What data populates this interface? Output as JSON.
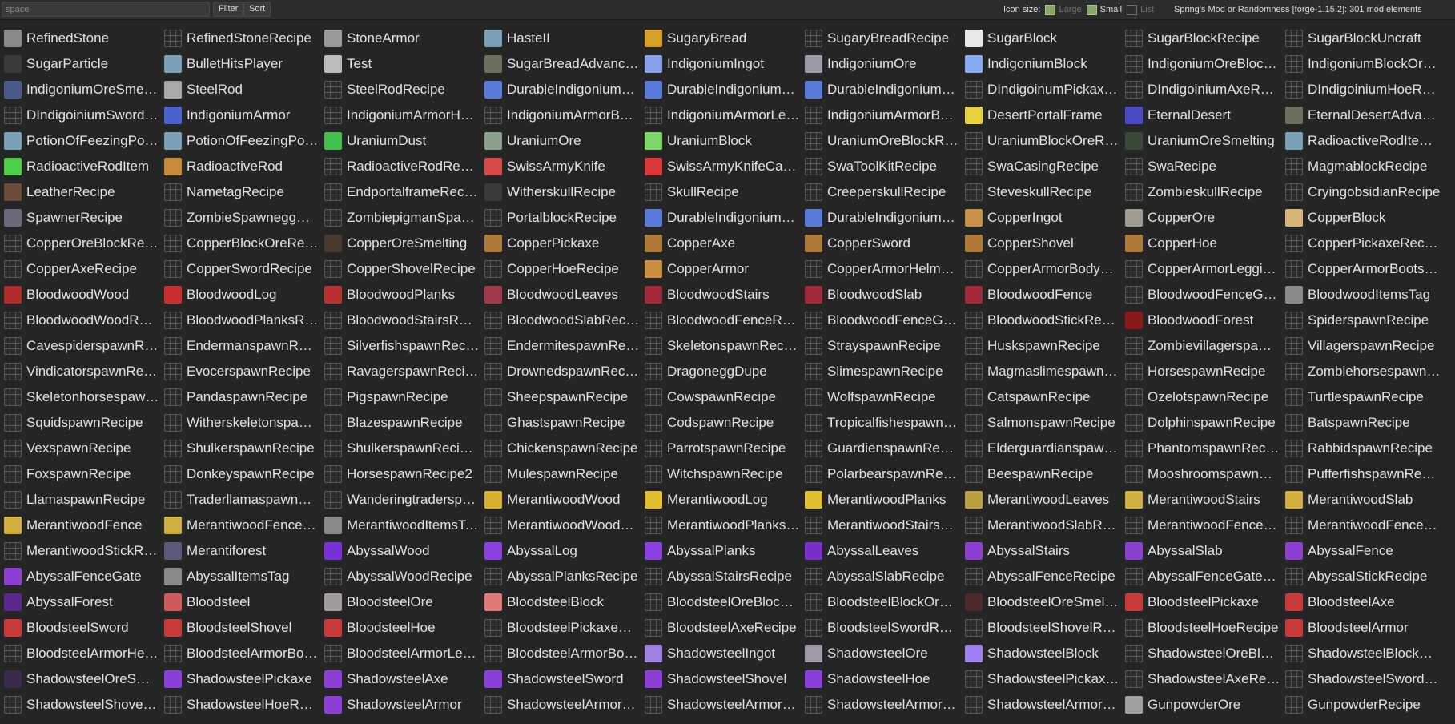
{
  "toolbar": {
    "search_placeholder": "space",
    "filter_label": "Filter",
    "sort_label": "Sort",
    "icon_size_label": "Icon size:",
    "large_label": "Large",
    "small_label": "Small",
    "list_label": "List",
    "workspace_info": "Spring's Mod or Randomness [forge-1.15.2]: 301 mod elements"
  },
  "elements": [
    {
      "name": "RefinedStone",
      "icon": "#8a8a8a"
    },
    {
      "name": "RefinedStoneRecipe",
      "icon": "recipe"
    },
    {
      "name": "StoneArmor",
      "icon": "#9a9a9a"
    },
    {
      "name": "HasteII",
      "icon": "#7aa0b8"
    },
    {
      "name": "SugaryBread",
      "icon": "#d9a12a"
    },
    {
      "name": "SugaryBreadRecipe",
      "icon": "recipe"
    },
    {
      "name": "SugarBlock",
      "icon": "#e8e8e8"
    },
    {
      "name": "SugarBlockRecipe",
      "icon": "recipe"
    },
    {
      "name": "SugarBlockUncraft",
      "icon": "recipe"
    },
    {
      "name": "SugarParticle",
      "icon": "#3a3a3a"
    },
    {
      "name": "BulletHitsPlayer",
      "icon": "#7aa0b8"
    },
    {
      "name": "Test",
      "icon": "#bbbbbb"
    },
    {
      "name": "SugarBreadAdvancement",
      "icon": "#6f6f5f"
    },
    {
      "name": "IndigoniumIngot",
      "icon": "#8aa0e8"
    },
    {
      "name": "IndigoniumOre",
      "icon": "#9a9aa8"
    },
    {
      "name": "IndigoniumBlock",
      "icon": "#8aaaf0"
    },
    {
      "name": "IndigoniumOreBlockRecipe",
      "icon": "recipe"
    },
    {
      "name": "IndigoniumBlockOreRecipe",
      "icon": "recipe"
    },
    {
      "name": "IndigoniumOreSmelting",
      "icon": "#4a5a8a"
    },
    {
      "name": "SteelRod",
      "icon": "#aaaaaa"
    },
    {
      "name": "SteelRodRecipe",
      "icon": "recipe"
    },
    {
      "name": "DurableIndigoniumPickaxe",
      "icon": "#5a7ad8"
    },
    {
      "name": "DurableIndigoniumAxe",
      "icon": "#5a7ad8"
    },
    {
      "name": "DurableIndigoniumSword",
      "icon": "#5a7ad8"
    },
    {
      "name": "DIndigoinumPickaxeRecipe",
      "icon": "recipe"
    },
    {
      "name": "DIndigoiniumAxeRecipe",
      "icon": "recipe"
    },
    {
      "name": "DIndigoiniumHoeRecipe",
      "icon": "recipe"
    },
    {
      "name": "DIndigoiniumSwordRecipe",
      "icon": "recipe"
    },
    {
      "name": "IndigoniumArmor",
      "icon": "#4a62d0"
    },
    {
      "name": "IndigoniumArmorHelmetRecipe",
      "icon": "recipe"
    },
    {
      "name": "IndigoniumArmorBodyRecipe",
      "icon": "recipe"
    },
    {
      "name": "IndigoniumArmorLeggingsRecipe",
      "icon": "recipe"
    },
    {
      "name": "IndigoniumArmorBootsRecipe",
      "icon": "recipe"
    },
    {
      "name": "DesertPortalFrame",
      "icon": "#e6d240"
    },
    {
      "name": "EternalDesert",
      "icon": "#4a4ac8"
    },
    {
      "name": "EternalDesertAdvancement",
      "icon": "#6f6f5f"
    },
    {
      "name": "PotionOfFeezingPotion",
      "icon": "#7aa0b8"
    },
    {
      "name": "PotionOfFeezingPotionEffect",
      "icon": "#7aa0b8"
    },
    {
      "name": "UraniumDust",
      "icon": "#3ec24a"
    },
    {
      "name": "UraniumOre",
      "icon": "#8aa08a"
    },
    {
      "name": "UraniumBlock",
      "icon": "#7ad86a"
    },
    {
      "name": "UraniumOreBlockRecipe",
      "icon": "recipe"
    },
    {
      "name": "UraniumBlockOreRecipe",
      "icon": "recipe"
    },
    {
      "name": "UraniumOreSmelting",
      "icon": "#3a4a3a"
    },
    {
      "name": "RadioactiveRodItemRecipe",
      "icon": "#7aa0b8"
    },
    {
      "name": "RadioactiveRodItem",
      "icon": "#4ad04a"
    },
    {
      "name": "RadioactiveRod",
      "icon": "#c88a3a"
    },
    {
      "name": "RadioactiveRodRecipe",
      "icon": "recipe"
    },
    {
      "name": "SwissArmyKnife",
      "icon": "#d84a4a"
    },
    {
      "name": "SwissArmyKnifeCasing",
      "icon": "#d83a3a"
    },
    {
      "name": "SwaToolKitRecipe",
      "icon": "recipe"
    },
    {
      "name": "SwaCasingRecipe",
      "icon": "recipe"
    },
    {
      "name": "SwaRecipe",
      "icon": "recipe"
    },
    {
      "name": "MagmablockRecipe",
      "icon": "recipe"
    },
    {
      "name": "LeatherRecipe",
      "icon": "#6a4a3a"
    },
    {
      "name": "NametagRecipe",
      "icon": "recipe"
    },
    {
      "name": "EndportalframeRecipe",
      "icon": "recipe"
    },
    {
      "name": "WitherskullRecipe",
      "icon": "#3a3a3a"
    },
    {
      "name": "SkullRecipe",
      "icon": "recipe"
    },
    {
      "name": "CreeperskullRecipe",
      "icon": "recipe"
    },
    {
      "name": "SteveskullRecipe",
      "icon": "recipe"
    },
    {
      "name": "ZombieskullRecipe",
      "icon": "recipe"
    },
    {
      "name": "CryingobsidianRecipe",
      "icon": "recipe"
    },
    {
      "name": "SpawnerRecipe",
      "icon": "#6a6a7a"
    },
    {
      "name": "ZombieSpawneggRecipe",
      "icon": "recipe"
    },
    {
      "name": "ZombiepigmanSpawneggRecipe",
      "icon": "recipe"
    },
    {
      "name": "PortalblockRecipe",
      "icon": "recipe"
    },
    {
      "name": "DurableIndigoniumShovel",
      "icon": "#5a7ad8"
    },
    {
      "name": "DurableIndigoniumHoe",
      "icon": "#5a7ad8"
    },
    {
      "name": "CopperIngot",
      "icon": "#c8904a"
    },
    {
      "name": "CopperOre",
      "icon": "#a09a90"
    },
    {
      "name": "CopperBlock",
      "icon": "#d8b47a"
    },
    {
      "name": "CopperOreBlockRecipe",
      "icon": "recipe"
    },
    {
      "name": "CopperBlockOreRecipe",
      "icon": "recipe"
    },
    {
      "name": "CopperOreSmelting",
      "icon": "#4a3a2a"
    },
    {
      "name": "CopperPickaxe",
      "icon": "#b0783a"
    },
    {
      "name": "CopperAxe",
      "icon": "#b0783a"
    },
    {
      "name": "CopperSword",
      "icon": "#b0783a"
    },
    {
      "name": "CopperShovel",
      "icon": "#b0783a"
    },
    {
      "name": "CopperHoe",
      "icon": "#b0783a"
    },
    {
      "name": "CopperPickaxeRecipe",
      "icon": "recipe"
    },
    {
      "name": "CopperAxeRecipe",
      "icon": "recipe"
    },
    {
      "name": "CopperSwordRecipe",
      "icon": "recipe"
    },
    {
      "name": "CopperShovelRecipe",
      "icon": "recipe"
    },
    {
      "name": "CopperHoeRecipe",
      "icon": "recipe"
    },
    {
      "name": "CopperArmor",
      "icon": "#c89040"
    },
    {
      "name": "CopperArmorHelmetRecipe",
      "icon": "recipe"
    },
    {
      "name": "CopperArmorBodyRecipe",
      "icon": "recipe"
    },
    {
      "name": "CopperArmorLeggingsRecipe",
      "icon": "recipe"
    },
    {
      "name": "CopperArmorBootsRecipe",
      "icon": "recipe"
    },
    {
      "name": "BloodwoodWood",
      "icon": "#b02a2a"
    },
    {
      "name": "BloodwoodLog",
      "icon": "#c83030"
    },
    {
      "name": "BloodwoodPlanks",
      "icon": "#b83030"
    },
    {
      "name": "BloodwoodLeaves",
      "icon": "#a03a4a"
    },
    {
      "name": "BloodwoodStairs",
      "icon": "#a02a3a"
    },
    {
      "name": "BloodwoodSlab",
      "icon": "#a02a3a"
    },
    {
      "name": "BloodwoodFence",
      "icon": "#a02a3a"
    },
    {
      "name": "BloodwoodFenceGateRecipe",
      "icon": "recipe"
    },
    {
      "name": "BloodwoodItemsTag",
      "icon": "#8a8a8a"
    },
    {
      "name": "BloodwoodWoodRecipe",
      "icon": "recipe"
    },
    {
      "name": "BloodwoodPlanksRecipe",
      "icon": "recipe"
    },
    {
      "name": "BloodwoodStairsRecipe",
      "icon": "recipe"
    },
    {
      "name": "BloodwoodSlabRecipe",
      "icon": "recipe"
    },
    {
      "name": "BloodwoodFenceRecipe",
      "icon": "recipe"
    },
    {
      "name": "BloodwoodFenceGateRecipe",
      "icon": "recipe"
    },
    {
      "name": "BloodwoodStickRecipe",
      "icon": "recipe"
    },
    {
      "name": "BloodwoodForest",
      "icon": "#8a1a1a"
    },
    {
      "name": "SpiderspawnRecipe",
      "icon": "recipe"
    },
    {
      "name": "CavespiderspawnRecipe",
      "icon": "recipe"
    },
    {
      "name": "EndermanspawnRecipe",
      "icon": "recipe"
    },
    {
      "name": "SilverfishspawnRecipe",
      "icon": "recipe"
    },
    {
      "name": "EndermitespawnRecipe",
      "icon": "recipe"
    },
    {
      "name": "SkeletonspawnRecipe",
      "icon": "recipe"
    },
    {
      "name": "StrayspawnRecipe",
      "icon": "recipe"
    },
    {
      "name": "HuskspawnRecipe",
      "icon": "recipe"
    },
    {
      "name": "ZombievillagerspawnRecipe",
      "icon": "recipe"
    },
    {
      "name": "VillagerspawnRecipe",
      "icon": "recipe"
    },
    {
      "name": "VindicatorspawnRecipe",
      "icon": "recipe"
    },
    {
      "name": "EvocerspawnRecipe",
      "icon": "recipe"
    },
    {
      "name": "RavagerspawnRecipe",
      "icon": "recipe"
    },
    {
      "name": "DrownedspawnRecipe",
      "icon": "recipe"
    },
    {
      "name": "DragoneggDupe",
      "icon": "recipe"
    },
    {
      "name": "SlimespawnRecipe",
      "icon": "recipe"
    },
    {
      "name": "MagmaslimespawnRecipe",
      "icon": "recipe"
    },
    {
      "name": "HorsespawnRecipe",
      "icon": "recipe"
    },
    {
      "name": "ZombiehorsespawnRecipe",
      "icon": "recipe"
    },
    {
      "name": "SkeletonhorsespawnRecipe",
      "icon": "recipe"
    },
    {
      "name": "PandaspawnRecipe",
      "icon": "recipe"
    },
    {
      "name": "PigspawnRecipe",
      "icon": "recipe"
    },
    {
      "name": "SheepspawnRecipe",
      "icon": "recipe"
    },
    {
      "name": "CowspawnRecipe",
      "icon": "recipe"
    },
    {
      "name": "WolfspawnRecipe",
      "icon": "recipe"
    },
    {
      "name": "CatspawnRecipe",
      "icon": "recipe"
    },
    {
      "name": "OzelotspawnRecipe",
      "icon": "recipe"
    },
    {
      "name": "TurtlespawnRecipe",
      "icon": "recipe"
    },
    {
      "name": "SquidspawnRecipe",
      "icon": "recipe"
    },
    {
      "name": "WitherskeletonspawnRecipe",
      "icon": "recipe"
    },
    {
      "name": "BlazespawnRecipe",
      "icon": "recipe"
    },
    {
      "name": "GhastspawnRecipe",
      "icon": "recipe"
    },
    {
      "name": "CodspawnRecipe",
      "icon": "recipe"
    },
    {
      "name": "TropicalfishespawnRecipe",
      "icon": "recipe"
    },
    {
      "name": "SalmonspawnRecipe",
      "icon": "recipe"
    },
    {
      "name": "DolphinspawnRecipe",
      "icon": "recipe"
    },
    {
      "name": "BatspawnRecipe",
      "icon": "recipe"
    },
    {
      "name": "VexspawnRecipe",
      "icon": "recipe"
    },
    {
      "name": "ShulkerspawnRecipe",
      "icon": "recipe"
    },
    {
      "name": "ShulkerspawnRecipe2",
      "icon": "recipe"
    },
    {
      "name": "ChickenspawnRecipe",
      "icon": "recipe"
    },
    {
      "name": "ParrotspawnRecipe",
      "icon": "recipe"
    },
    {
      "name": "GuardienspawnRecipe",
      "icon": "recipe"
    },
    {
      "name": "ElderguardianspawnRecipe",
      "icon": "recipe"
    },
    {
      "name": "PhantomspawnRecipe",
      "icon": "recipe"
    },
    {
      "name": "RabbidspawnRecipe",
      "icon": "recipe"
    },
    {
      "name": "FoxspawnRecipe",
      "icon": "recipe"
    },
    {
      "name": "DonkeyspawnRecipe",
      "icon": "recipe"
    },
    {
      "name": "HorsespawnRecipe2",
      "icon": "recipe"
    },
    {
      "name": "MulespawnRecipe",
      "icon": "recipe"
    },
    {
      "name": "WitchspawnRecipe",
      "icon": "recipe"
    },
    {
      "name": "PolarbearspawnRecipe",
      "icon": "recipe"
    },
    {
      "name": "BeespawnRecipe",
      "icon": "recipe"
    },
    {
      "name": "MooshroomspawnRecipe",
      "icon": "recipe"
    },
    {
      "name": "PufferfishspawnRecipe",
      "icon": "recipe"
    },
    {
      "name": "LlamaspawnRecipe",
      "icon": "recipe"
    },
    {
      "name": "TraderllamaspawnRecipe",
      "icon": "recipe"
    },
    {
      "name": "WanderingtraderspawnRecipe",
      "icon": "recipe"
    },
    {
      "name": "MerantiwoodWood",
      "icon": "#d8b030"
    },
    {
      "name": "MerantiwoodLog",
      "icon": "#e0bc30"
    },
    {
      "name": "MerantiwoodPlanks",
      "icon": "#e0bc30"
    },
    {
      "name": "MerantiwoodLeaves",
      "icon": "#b8a040"
    },
    {
      "name": "MerantiwoodStairs",
      "icon": "#d0b040"
    },
    {
      "name": "MerantiwoodSlab",
      "icon": "#d0b040"
    },
    {
      "name": "MerantiwoodFence",
      "icon": "#d0b040"
    },
    {
      "name": "MerantiwoodFenceGate",
      "icon": "#d0b040"
    },
    {
      "name": "MerantiwoodItemsTag",
      "icon": "#8a8a8a"
    },
    {
      "name": "MerantiwoodWoodRecipe",
      "icon": "recipe"
    },
    {
      "name": "MerantiwoodPlanksRecipe",
      "icon": "recipe"
    },
    {
      "name": "MerantiwoodStairsRecipe",
      "icon": "recipe"
    },
    {
      "name": "MerantiwoodSlabRecipe",
      "icon": "recipe"
    },
    {
      "name": "MerantiwoodFenceRecipe",
      "icon": "recipe"
    },
    {
      "name": "MerantiwoodFenceGateRecipe",
      "icon": "recipe"
    },
    {
      "name": "MerantiwoodStickRecipe",
      "icon": "recipe"
    },
    {
      "name": "Merantiforest",
      "icon": "#5a5a7a"
    },
    {
      "name": "AbyssalWood",
      "icon": "#7a30d8"
    },
    {
      "name": "AbyssalLog",
      "icon": "#8a40e0"
    },
    {
      "name": "AbyssalPlanks",
      "icon": "#8a40e0"
    },
    {
      "name": "AbyssalLeaves",
      "icon": "#7a30c8"
    },
    {
      "name": "AbyssalStairs",
      "icon": "#8a40d0"
    },
    {
      "name": "AbyssalSlab",
      "icon": "#8a40d0"
    },
    {
      "name": "AbyssalFence",
      "icon": "#8a40d0"
    },
    {
      "name": "AbyssalFenceGate",
      "icon": "#8a40d0"
    },
    {
      "name": "AbyssalItemsTag",
      "icon": "#8a8a8a"
    },
    {
      "name": "AbyssalWoodRecipe",
      "icon": "recipe"
    },
    {
      "name": "AbyssalPlanksRecipe",
      "icon": "recipe"
    },
    {
      "name": "AbyssalStairsRecipe",
      "icon": "recipe"
    },
    {
      "name": "AbyssalSlabRecipe",
      "icon": "recipe"
    },
    {
      "name": "AbyssalFenceRecipe",
      "icon": "recipe"
    },
    {
      "name": "AbyssalFenceGateRecipe",
      "icon": "recipe"
    },
    {
      "name": "AbyssalStickRecipe",
      "icon": "recipe"
    },
    {
      "name": "AbyssalForest",
      "icon": "#5a2a8a"
    },
    {
      "name": "Bloodsteel",
      "icon": "#d05a5a"
    },
    {
      "name": "BloodsteelOre",
      "icon": "#a09a9a"
    },
    {
      "name": "BloodsteelBlock",
      "icon": "#e07a7a"
    },
    {
      "name": "BloodsteelOreBlockRecipe",
      "icon": "recipe"
    },
    {
      "name": "BloodsteelBlockOreRecipe",
      "icon": "recipe"
    },
    {
      "name": "BloodsteelOreSmelting",
      "icon": "#4a2a2a"
    },
    {
      "name": "BloodsteelPickaxe",
      "icon": "#c83a3a"
    },
    {
      "name": "BloodsteelAxe",
      "icon": "#c83a3a"
    },
    {
      "name": "BloodsteelSword",
      "icon": "#c83a3a"
    },
    {
      "name": "BloodsteelShovel",
      "icon": "#c83a3a"
    },
    {
      "name": "BloodsteelHoe",
      "icon": "#c83a3a"
    },
    {
      "name": "BloodsteelPickaxeRecipe",
      "icon": "recipe"
    },
    {
      "name": "BloodsteelAxeRecipe",
      "icon": "recipe"
    },
    {
      "name": "BloodsteelSwordRecipe",
      "icon": "recipe"
    },
    {
      "name": "BloodsteelShovelRecipe",
      "icon": "recipe"
    },
    {
      "name": "BloodsteelHoeRecipe",
      "icon": "recipe"
    },
    {
      "name": "BloodsteelArmor",
      "icon": "#c83a3a"
    },
    {
      "name": "BloodsteelArmorHelmetRecipe",
      "icon": "recipe"
    },
    {
      "name": "BloodsteelArmorBodyRecipe",
      "icon": "recipe"
    },
    {
      "name": "BloodsteelArmorLeggingsRecipe",
      "icon": "recipe"
    },
    {
      "name": "BloodsteelArmorBootsRecipe",
      "icon": "recipe"
    },
    {
      "name": "ShadowsteelIngot",
      "icon": "#a080e0"
    },
    {
      "name": "ShadowsteelOre",
      "icon": "#a09aa8"
    },
    {
      "name": "ShadowsteelBlock",
      "icon": "#a080f0"
    },
    {
      "name": "ShadowsteelOreBlockRecipe",
      "icon": "recipe"
    },
    {
      "name": "ShadowsteelBlockOreRecipe",
      "icon": "recipe"
    },
    {
      "name": "ShadowsteelOreSmelting",
      "icon": "#3a2a4a"
    },
    {
      "name": "ShadowsteelPickaxe",
      "icon": "#8a40d8"
    },
    {
      "name": "ShadowsteelAxe",
      "icon": "#8a40d8"
    },
    {
      "name": "ShadowsteelSword",
      "icon": "#8a40d8"
    },
    {
      "name": "ShadowsteelShovel",
      "icon": "#8a40d8"
    },
    {
      "name": "ShadowsteelHoe",
      "icon": "#8a40d8"
    },
    {
      "name": "ShadowsteelPickaxeRecipe",
      "icon": "recipe"
    },
    {
      "name": "ShadowsteelAxeRecipe",
      "icon": "recipe"
    },
    {
      "name": "ShadowsteelSwordRecipe",
      "icon": "recipe"
    },
    {
      "name": "ShadowsteelShovelRecipe",
      "icon": "recipe"
    },
    {
      "name": "ShadowsteelHoeRecipe",
      "icon": "recipe"
    },
    {
      "name": "ShadowsteelArmor",
      "icon": "#8a40d8"
    },
    {
      "name": "ShadowsteelArmorHelmetRecipe",
      "icon": "recipe"
    },
    {
      "name": "ShadowsteelArmorBodyRecipe",
      "icon": "recipe"
    },
    {
      "name": "ShadowsteelArmorLeggingsRecipe",
      "icon": "recipe"
    },
    {
      "name": "ShadowsteelArmorBootsRecipe",
      "icon": "recipe"
    },
    {
      "name": "GunpowderOre",
      "icon": "#a0a0a0"
    },
    {
      "name": "GunpowderRecipe",
      "icon": "recipe"
    }
  ]
}
